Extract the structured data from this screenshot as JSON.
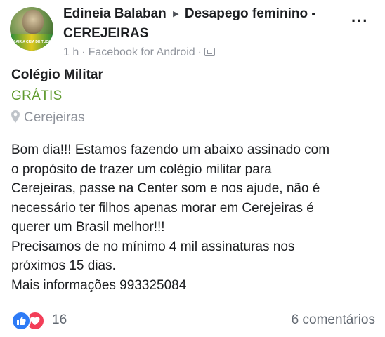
{
  "post": {
    "author": "Edineia Balaban",
    "group": "Desapego feminino -",
    "group_line2": "CEREJEIRAS",
    "time": "1 h",
    "source": "Facebook for Android",
    "privacy_icon": "group-members-icon",
    "avatar_text": "SAIR A CRIA DE TUDO",
    "more_label": "..."
  },
  "listing": {
    "title": "Colégio Militar",
    "price": "GRÁTIS",
    "location": "Cerejeiras"
  },
  "body_lines": [
    "Bom dia!!! Estamos fazendo um abaixo assinado com",
    "o propósito de trazer um colégio militar para",
    "Cerejeiras, passe na Center som e nos ajude, não é",
    "necessário ter filhos apenas morar em Cerejeiras é",
    "querer um Brasil melhor!!!",
    "Precisamos de no mínimo 4 mil assinaturas nos",
    "próximos 15 dias.",
    "Mais informações 993325084"
  ],
  "footer": {
    "reaction_count": "16",
    "comments": "6 comentários"
  },
  "colors": {
    "price": "#5f9a2d",
    "like": "#2e7bf6",
    "love": "#f33e58",
    "meta": "#90949c"
  }
}
